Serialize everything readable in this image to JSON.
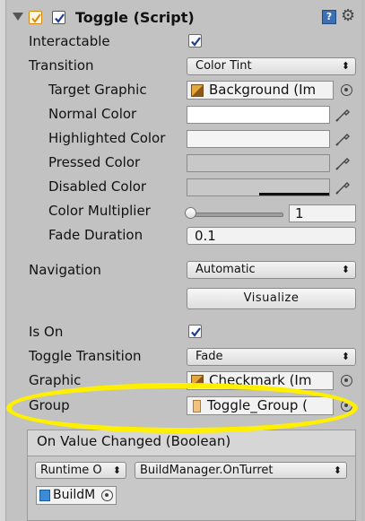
{
  "component": {
    "title": "Toggle (Script)",
    "help_icon": "help-book-icon",
    "settings_icon": "gear-icon"
  },
  "fields": {
    "interactable": {
      "label": "Interactable",
      "checked": true
    },
    "transition": {
      "label": "Transition",
      "value": "Color Tint"
    },
    "target_graphic": {
      "label": "Target Graphic",
      "value": "Background (Im"
    },
    "normal_color": {
      "label": "Normal Color",
      "color": "#ffffff"
    },
    "highlighted_color": {
      "label": "Highlighted Color",
      "color": "#f5f5f5"
    },
    "pressed_color": {
      "label": "Pressed Color",
      "color": "#c8c8c8"
    },
    "disabled_color": {
      "label": "Disabled Color",
      "color": "#c8c8c8"
    },
    "color_multiplier": {
      "label": "Color Multiplier",
      "value": "1",
      "slider_fraction": 0.0
    },
    "fade_duration": {
      "label": "Fade Duration",
      "value": "0.1"
    },
    "navigation": {
      "label": "Navigation",
      "value": "Automatic",
      "visualize_label": "Visualize"
    },
    "is_on": {
      "label": "Is On",
      "checked": true
    },
    "toggle_transition": {
      "label": "Toggle Transition",
      "value": "Fade"
    },
    "graphic": {
      "label": "Graphic",
      "value": "Checkmark (Im"
    },
    "group": {
      "label": "Group",
      "value": "Toggle_Group ("
    }
  },
  "event": {
    "title": "On Value Changed (Boolean)",
    "runtime_value": "Runtime O",
    "function_value": "BuildManager.OnTurret",
    "object_value": "BuildM"
  },
  "colors": {
    "highlight": "#ffef00",
    "checkmark": "#1f3d8a"
  }
}
